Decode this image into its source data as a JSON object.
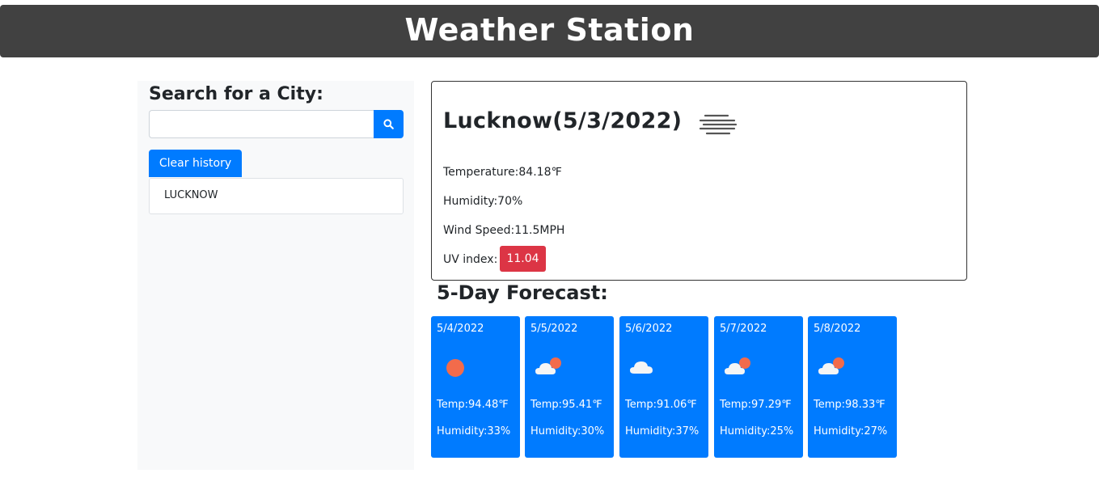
{
  "header": {
    "title": "Weather Station"
  },
  "sidebar": {
    "search_heading": "Search for a City:",
    "search_value": "",
    "search_placeholder": "",
    "search_icon": "search-icon",
    "clear_label": "Clear history",
    "history": [
      "LUCKNOW"
    ]
  },
  "current": {
    "city_date": "Lucknow(5/3/2022)",
    "icon": "mist-icon",
    "temperature": "Temperature:84.18℉",
    "humidity": "Humidity:70%",
    "wind": "Wind Speed:11.5MPH",
    "uv_label": "UV index:",
    "uv_value": "11.04"
  },
  "forecast": {
    "title": "5-Day Forecast:",
    "days": [
      {
        "date": "5/4/2022",
        "icon": "sun-icon",
        "temp": "Temp:94.48℉",
        "humidity": "Humidity:33%"
      },
      {
        "date": "5/5/2022",
        "icon": "partly-cloudy-icon",
        "temp": "Temp:95.41℉",
        "humidity": "Humidity:30%"
      },
      {
        "date": "5/6/2022",
        "icon": "cloud-icon",
        "temp": "Temp:91.06℉",
        "humidity": "Humidity:37%"
      },
      {
        "date": "5/7/2022",
        "icon": "partly-cloudy-icon",
        "temp": "Temp:97.29℉",
        "humidity": "Humidity:25%"
      },
      {
        "date": "5/8/2022",
        "icon": "partly-cloudy-icon",
        "temp": "Temp:98.33℉",
        "humidity": "Humidity:27%"
      }
    ]
  },
  "colors": {
    "header_bg": "#414141",
    "primary": "#007bff",
    "danger": "#dc3545",
    "sidebar_bg": "#f8f9fa",
    "sun": "#f26b4b",
    "cloud": "#f5f5f5"
  }
}
